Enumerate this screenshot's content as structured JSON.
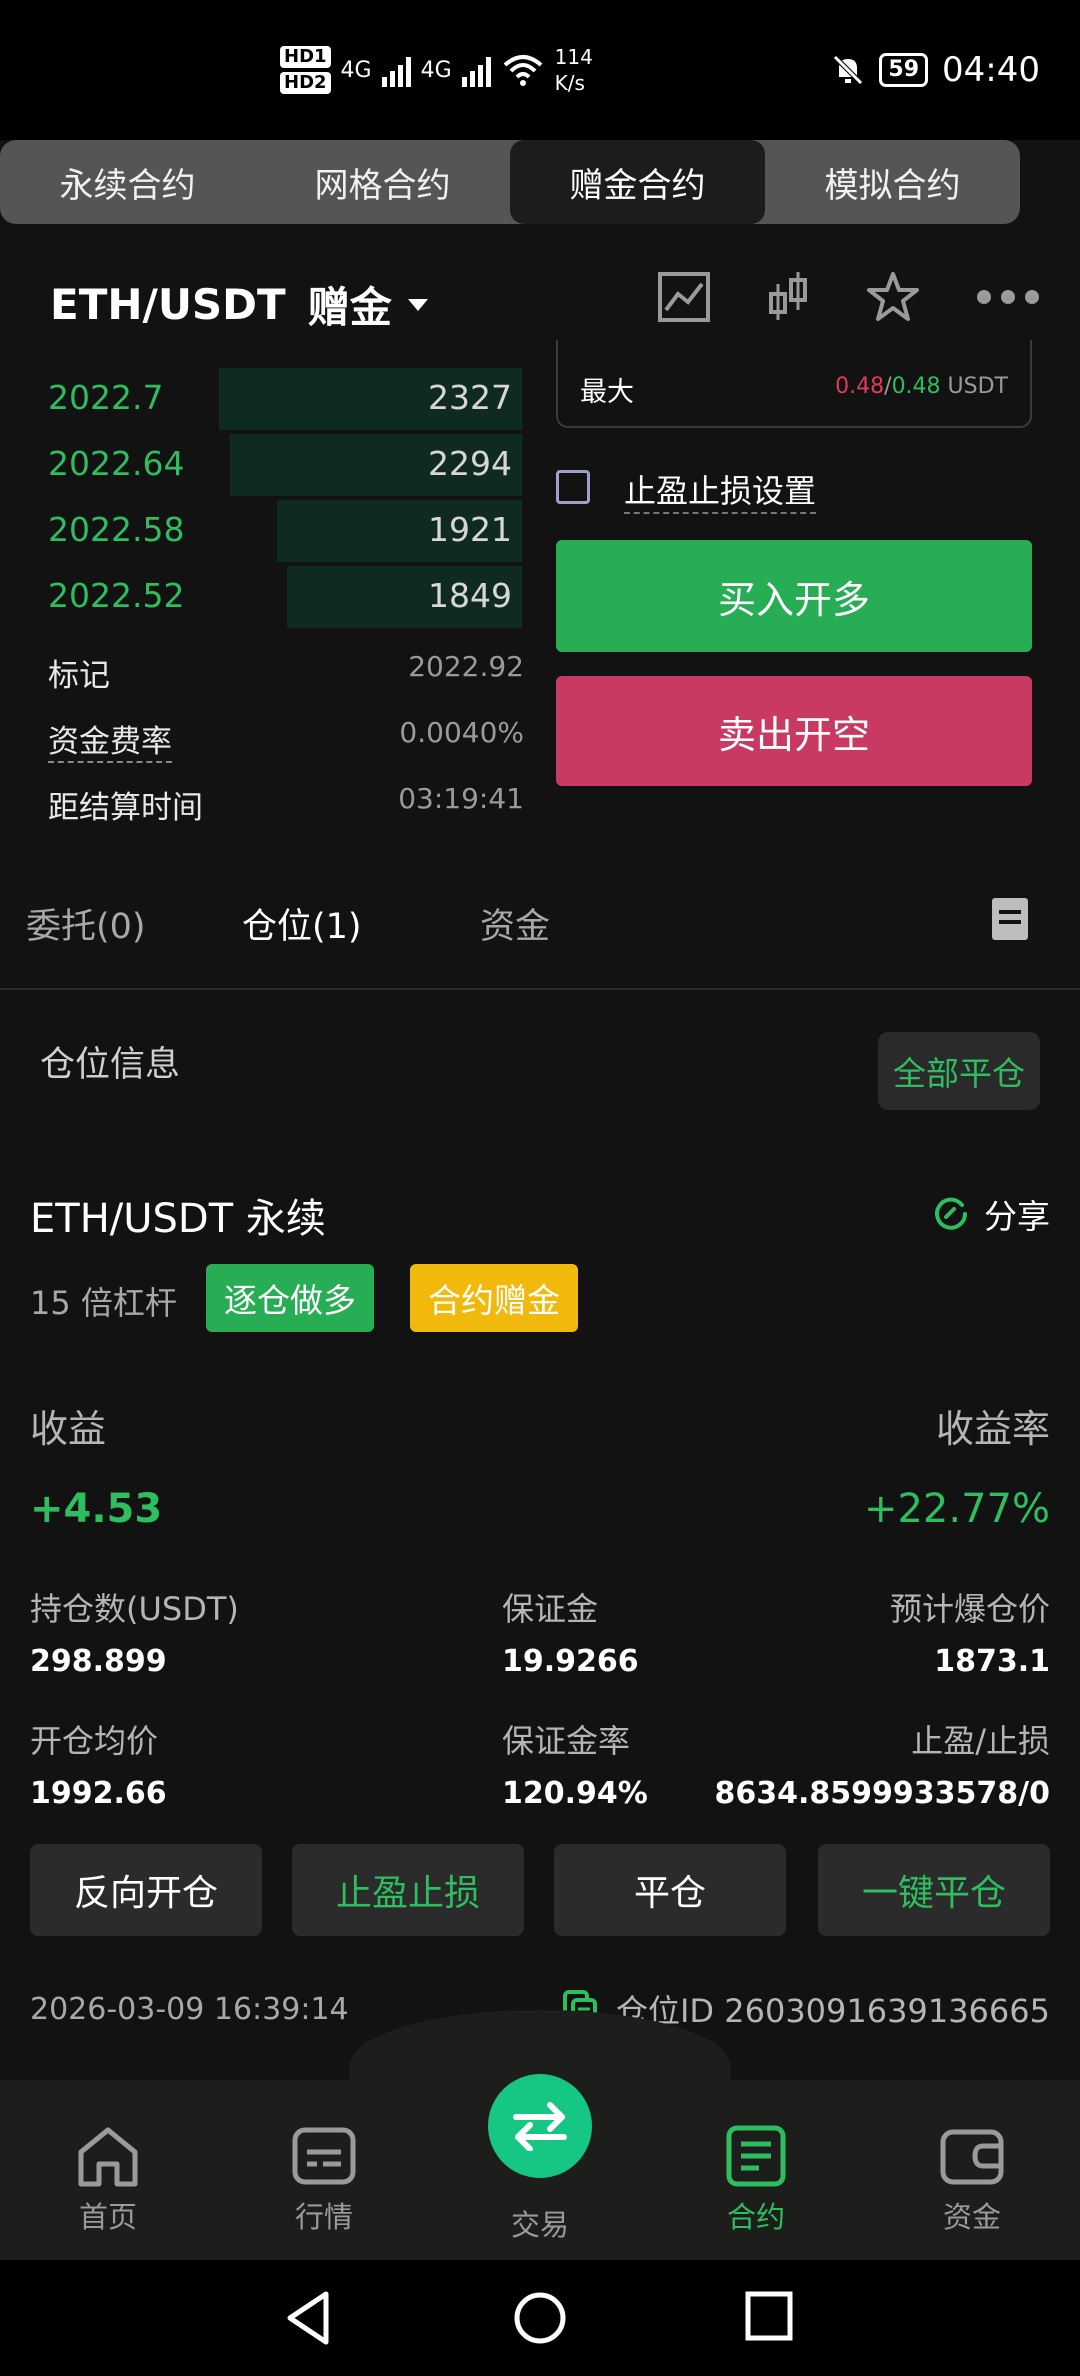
{
  "status_bar": {
    "hd1": "HD1",
    "hd2": "HD2",
    "net1": "4G",
    "net2": "4G",
    "speed_value": "114",
    "speed_unit": "K/s",
    "battery": "59",
    "time": "04:40"
  },
  "top_tabs": [
    {
      "label": "永续合约",
      "active": false
    },
    {
      "label": "网格合约",
      "active": false
    },
    {
      "label": "赠金合约",
      "active": true
    },
    {
      "label": "模拟合约",
      "active": false
    }
  ],
  "header": {
    "pair": "ETH/USDT",
    "mode": "赠金"
  },
  "orderbook": {
    "bids": [
      {
        "price": "2022.7",
        "qty": "2327",
        "depth": 0.58
      },
      {
        "price": "2022.64",
        "qty": "2294",
        "depth": 0.56
      },
      {
        "price": "2022.58",
        "qty": "1921",
        "depth": 0.47
      },
      {
        "price": "2022.52",
        "qty": "1849",
        "depth": 0.45
      }
    ],
    "mark_label": "标记",
    "mark_value": "2022.92",
    "funding_label": "资金费率",
    "funding_value": "0.0040%",
    "settle_label": "距结算时间",
    "settle_value": "03:19:41"
  },
  "trade_panel": {
    "max_label": "最大",
    "max_sell": "0.48",
    "max_sep": "/",
    "max_buy": "0.48",
    "max_unit": "USDT",
    "tpsl_label": "止盈止损设置",
    "buy_label": "买入开多",
    "sell_label": "卖出开空"
  },
  "lower_tabs": [
    {
      "label": "委托(0)",
      "active": false
    },
    {
      "label": "仓位(1)",
      "active": true
    },
    {
      "label": "资金",
      "active": false
    }
  ],
  "position": {
    "section_title": "仓位信息",
    "close_all": "全部平仓",
    "pair": "ETH/USDT 永续",
    "share": "分享",
    "leverage": "15 倍杠杆",
    "badge_side": "逐仓做多",
    "badge_type": "合约赠金",
    "pnl_label": "收益",
    "pnl_value": "+4.53",
    "roe_label": "收益率",
    "roe_value": "+22.77%",
    "size_label": "持仓数(USDT)",
    "size_value": "298.899",
    "margin_label": "保证金",
    "margin_value": "19.9266",
    "liq_label": "预计爆仓价",
    "liq_value": "1873.1",
    "entry_label": "开仓均价",
    "entry_value": "1992.66",
    "margin_ratio_label": "保证金率",
    "margin_ratio_value": "120.94%",
    "tpsl_label": "止盈/止损",
    "tpsl_value": "8634.8599933578/0",
    "btn_reverse": "反向开仓",
    "btn_tpsl": "止盈止损",
    "btn_close": "平仓",
    "btn_quick_close": "一键平仓",
    "time": "2026-03-09 16:39:14",
    "id_label": "仓位ID 2603091639136665"
  },
  "bottom_nav": [
    {
      "label": "首页",
      "icon": "home-icon",
      "active": false
    },
    {
      "label": "行情",
      "icon": "market-icon",
      "active": false
    },
    {
      "label": "交易",
      "icon": "swap-icon",
      "active": false
    },
    {
      "label": "合约",
      "icon": "contract-icon",
      "active": true
    },
    {
      "label": "资金",
      "icon": "wallet-icon",
      "active": false
    }
  ],
  "colors": {
    "green": "#2ebd5f",
    "red": "#c93a63",
    "yellow": "#f0b90b",
    "background": "#121212"
  }
}
